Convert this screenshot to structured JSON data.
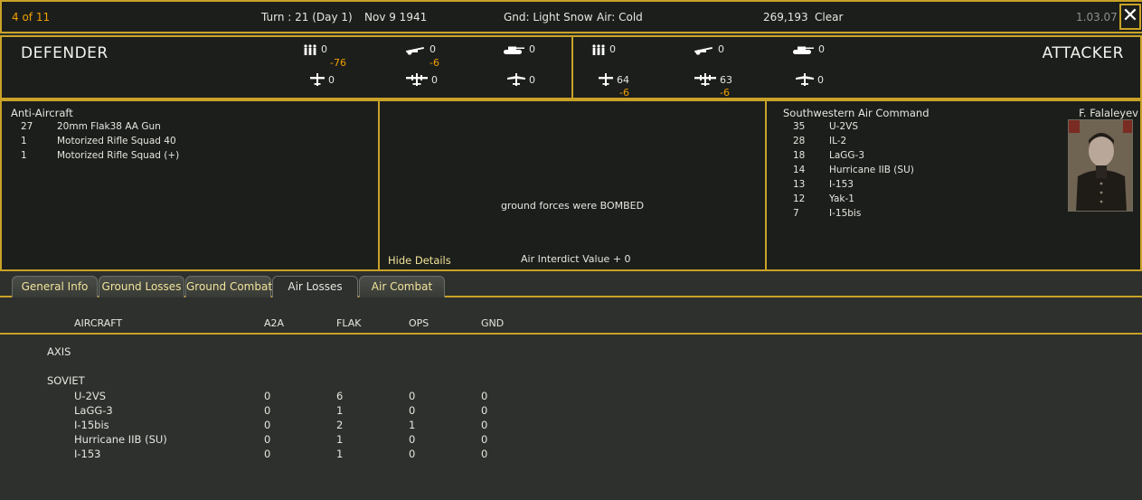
{
  "header": {
    "page_counter": "4 of 11",
    "turn": "Turn : 21 (Day 1)",
    "date": "Nov 9 1941",
    "ground": "Gnd: Light Snow",
    "air": "Air: Cold",
    "location": "269,193",
    "weather": "Clear",
    "version": "1.03.07",
    "close_glyph": "✕"
  },
  "defender": {
    "title": "DEFENDER",
    "men": "0",
    "men_delta": "-76",
    "guns": "0",
    "guns_delta": "-6",
    "afv": "0",
    "fighters": "0",
    "bombers": "0",
    "recon": "0"
  },
  "attacker": {
    "title": "ATTACKER",
    "men": "0",
    "guns": "0",
    "afv": "0",
    "fighters": "64",
    "fighters_delta": "-6",
    "bombers": "63",
    "bombers_delta": "-6",
    "recon": "0"
  },
  "defender_units": {
    "heading": "Anti-Aircraft",
    "rows": [
      {
        "count": "27",
        "name": "20mm Flak38 AA Gun"
      },
      {
        "count": "1",
        "name": "Motorized Rifle Squad 40"
      },
      {
        "count": "1",
        "name": "Motorized Rifle Squad (+)"
      }
    ]
  },
  "center": {
    "message": "ground forces were BOMBED",
    "hide_details": "Hide Details",
    "interdict": "Air Interdict Value  + 0"
  },
  "attacker_units": {
    "heading": "Southwestern Air Command",
    "commander": "F. Falaleyev",
    "rows": [
      {
        "count": "35",
        "name": "U-2VS"
      },
      {
        "count": "28",
        "name": "IL-2"
      },
      {
        "count": "18",
        "name": "LaGG-3"
      },
      {
        "count": "14",
        "name": "Hurricane IIB (SU)"
      },
      {
        "count": "13",
        "name": "I-153"
      },
      {
        "count": "12",
        "name": "Yak-1"
      },
      {
        "count": "7",
        "name": "I-15bis"
      }
    ]
  },
  "tabs": [
    "General Info",
    "Ground Losses",
    "Ground Combat",
    "Air Losses",
    "Air Combat"
  ],
  "active_tab": "Air Losses",
  "table": {
    "columns": [
      "AIRCRAFT",
      "A2A",
      "FLAK",
      "OPS",
      "GND"
    ],
    "axis_label": "AXIS",
    "soviet_label": "SOVIET",
    "rows": [
      {
        "aircraft": "U-2VS",
        "a2a": "0",
        "flak": "6",
        "ops": "0",
        "gnd": "0"
      },
      {
        "aircraft": "LaGG-3",
        "a2a": "0",
        "flak": "1",
        "ops": "0",
        "gnd": "0"
      },
      {
        "aircraft": "I-15bis",
        "a2a": "0",
        "flak": "2",
        "ops": "1",
        "gnd": "0"
      },
      {
        "aircraft": "Hurricane IIB (SU)",
        "a2a": "0",
        "flak": "1",
        "ops": "0",
        "gnd": "0"
      },
      {
        "aircraft": "I-153",
        "a2a": "0",
        "flak": "1",
        "ops": "0",
        "gnd": "0"
      }
    ]
  },
  "colors": {
    "border": "#c9a227",
    "panel_bg": "#1c1e1b",
    "body_bg": "#2d302c",
    "delta": "#f0a000",
    "tab_text": "#f2e49a"
  },
  "icons": [
    "men-icon",
    "gun-icon",
    "tank-icon",
    "fighter-icon",
    "bomber-icon",
    "recon-plane-icon",
    "close-icon"
  ]
}
